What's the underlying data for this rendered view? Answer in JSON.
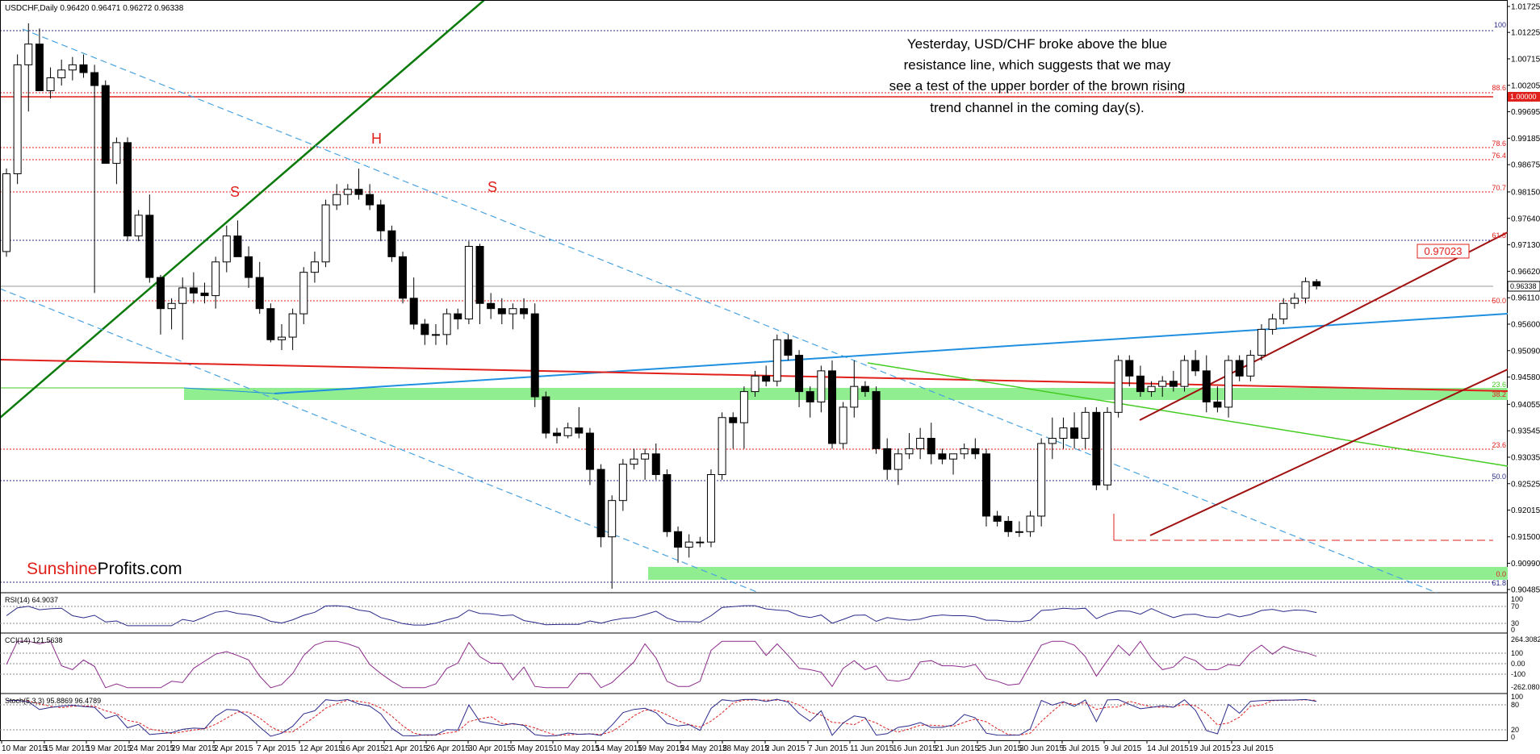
{
  "header": {
    "symbol_line": "USDCHF,Daily  0.96420 0.96471 0.96272 0.96338"
  },
  "annotation": {
    "lines": [
      "Yesterday, USD/CHF broke above the blue",
      "resistance line, which suggests that we may",
      "see a test of the upper border of the brown rising",
      "trend channel in the coming day(s)."
    ]
  },
  "watermark": {
    "part1": "Sunshine",
    "part2": "Profits.com"
  },
  "pattern_labels": [
    "S",
    "H",
    "S"
  ],
  "price_boxes": {
    "current": "0.96338",
    "level_100": "1.00000",
    "target": "0.97023"
  },
  "fib_labels": {
    "f100": "100",
    "f886": "88.6",
    "f786": "78.6",
    "f764": "76.4",
    "f707": "70.7",
    "f618a": "61.8",
    "f50a": "50.0",
    "f236a": "23.6",
    "f382": "38.2",
    "f236b": "23.6",
    "f50b": "50.0",
    "f0": "0.0",
    "f618b": "61.8"
  },
  "indicators": {
    "rsi": {
      "label": "RSI(14) 64.9037",
      "ticks": [
        "100",
        "70",
        "30",
        "0"
      ]
    },
    "cci": {
      "label": "CCI(14) 121.5638",
      "ticks": [
        "264.3082",
        "100",
        "0.00",
        "-100",
        "-262.0806"
      ]
    },
    "stoch": {
      "label": "Stoch(5,3,3) 95.8869 96.4789",
      "ticks": [
        "100",
        "80",
        "20",
        "0"
      ]
    }
  },
  "colors": {
    "bull": "#ffffff",
    "bear": "#000000",
    "trend_green": "#0a7a0a",
    "blue_dash": "#4aa3df",
    "blue_line": "#1f8fe0",
    "red_line": "#e0201a",
    "brown": "#a01010",
    "zone_green": "#90ee90",
    "light_green": "#44cc22",
    "indicator": "#2a2a8a",
    "cci_line": "#8b2a8b",
    "stoch_signal": "#e02020"
  },
  "chart_data": {
    "type": "candlestick",
    "title": "USDCHF,Daily",
    "ylim": [
      0.90485,
      1.01725
    ],
    "y_ticks": [
      "1.01725",
      "1.01225",
      "1.00715",
      "1.00205",
      "0.99695",
      "0.99185",
      "0.98675",
      "0.98150",
      "0.97640",
      "0.97130",
      "0.96620",
      "0.96110",
      "0.95600",
      "0.95090",
      "0.94580",
      "0.94055",
      "0.93545",
      "0.93035",
      "0.92525",
      "0.92015",
      "0.91500",
      "0.90990",
      "0.90485"
    ],
    "x_ticks": [
      "10 Mar 2015",
      "15 Mar 2015",
      "19 Mar 2015",
      "24 Mar 2015",
      "29 Mar 2015",
      "2 Apr 2015",
      "7 Apr 2015",
      "12 Apr 2015",
      "16 Apr 2015",
      "21 Apr 2015",
      "26 Apr 2015",
      "30 Apr 2015",
      "5 May 2015",
      "10 May 2015",
      "14 May 2015",
      "19 May 2015",
      "24 May 2015",
      "28 May 2015",
      "2 Jun 2015",
      "7 Jun 2015",
      "11 Jun 2015",
      "16 Jun 2015",
      "21 Jun 2015",
      "25 Jun 2015",
      "30 Jun 2015",
      "5 Jul 2015",
      "9 Jul 2015",
      "14 Jul 2015",
      "19 Jul 2015",
      "23 Jul 2015"
    ],
    "ohlc": [
      [
        0.97,
        0.986,
        0.969,
        0.985
      ],
      [
        0.985,
        1.008,
        0.983,
        1.006
      ],
      [
        1.006,
        1.014,
        0.997,
        1.01
      ],
      [
        1.01,
        1.013,
        1.001,
        1.001
      ],
      [
        1.001,
        1.0055,
        0.9995,
        1.0035
      ],
      [
        1.0035,
        1.007,
        1.002,
        1.005
      ],
      [
        1.005,
        1.0075,
        1.003,
        1.006
      ],
      [
        1.006,
        1.008,
        1.0035,
        1.0045
      ],
      [
        1.0045,
        1.006,
        0.962,
        1.002
      ],
      [
        1.002,
        1.003,
        0.987,
        0.987
      ],
      [
        0.987,
        0.992,
        0.983,
        0.991
      ],
      [
        0.991,
        0.992,
        0.972,
        0.973
      ],
      [
        0.973,
        0.978,
        0.972,
        0.977
      ],
      [
        0.977,
        0.981,
        0.964,
        0.965
      ],
      [
        0.965,
        0.9655,
        0.954,
        0.959
      ],
      [
        0.959,
        0.961,
        0.955,
        0.96
      ],
      [
        0.96,
        0.965,
        0.953,
        0.963
      ],
      [
        0.963,
        0.966,
        0.96,
        0.962
      ],
      [
        0.962,
        0.964,
        0.96,
        0.9615
      ],
      [
        0.9615,
        0.969,
        0.959,
        0.968
      ],
      [
        0.968,
        0.975,
        0.966,
        0.973
      ],
      [
        0.973,
        0.976,
        0.969,
        0.969
      ],
      [
        0.969,
        0.971,
        0.963,
        0.965
      ],
      [
        0.965,
        0.968,
        0.958,
        0.959
      ],
      [
        0.959,
        0.96,
        0.9525,
        0.953
      ],
      [
        0.953,
        0.956,
        0.951,
        0.9535
      ],
      [
        0.9535,
        0.959,
        0.951,
        0.958
      ],
      [
        0.958,
        0.967,
        0.956,
        0.966
      ],
      [
        0.966,
        0.97,
        0.964,
        0.968
      ],
      [
        0.968,
        0.98,
        0.967,
        0.979
      ],
      [
        0.979,
        0.983,
        0.978,
        0.981
      ],
      [
        0.981,
        0.983,
        0.979,
        0.982
      ],
      [
        0.982,
        0.986,
        0.98,
        0.981
      ],
      [
        0.981,
        0.983,
        0.978,
        0.979
      ],
      [
        0.979,
        0.98,
        0.972,
        0.974
      ],
      [
        0.974,
        0.975,
        0.968,
        0.969
      ],
      [
        0.969,
        0.97,
        0.96,
        0.961
      ],
      [
        0.961,
        0.965,
        0.955,
        0.956
      ],
      [
        0.956,
        0.957,
        0.952,
        0.954
      ],
      [
        0.954,
        0.956,
        0.952,
        0.954
      ],
      [
        0.954,
        0.959,
        0.952,
        0.958
      ],
      [
        0.958,
        0.959,
        0.955,
        0.957
      ],
      [
        0.957,
        0.972,
        0.956,
        0.971
      ],
      [
        0.971,
        0.9715,
        0.956,
        0.96
      ],
      [
        0.96,
        0.962,
        0.957,
        0.959
      ],
      [
        0.959,
        0.961,
        0.956,
        0.958
      ],
      [
        0.958,
        0.96,
        0.955,
        0.959
      ],
      [
        0.959,
        0.961,
        0.957,
        0.958
      ],
      [
        0.958,
        0.96,
        0.94,
        0.942
      ],
      [
        0.942,
        0.943,
        0.934,
        0.935
      ],
      [
        0.935,
        0.936,
        0.933,
        0.9345
      ],
      [
        0.9345,
        0.937,
        0.934,
        0.936
      ],
      [
        0.936,
        0.94,
        0.934,
        0.935
      ],
      [
        0.935,
        0.936,
        0.925,
        0.928
      ],
      [
        0.928,
        0.929,
        0.913,
        0.915
      ],
      [
        0.915,
        0.923,
        0.905,
        0.922
      ],
      [
        0.922,
        0.93,
        0.92,
        0.929
      ],
      [
        0.929,
        0.932,
        0.928,
        0.93
      ],
      [
        0.93,
        0.932,
        0.926,
        0.931
      ],
      [
        0.931,
        0.933,
        0.926,
        0.927
      ],
      [
        0.927,
        0.928,
        0.915,
        0.916
      ],
      [
        0.916,
        0.917,
        0.91,
        0.913
      ],
      [
        0.913,
        0.9155,
        0.911,
        0.914
      ],
      [
        0.914,
        0.915,
        0.913,
        0.914
      ],
      [
        0.914,
        0.928,
        0.913,
        0.927
      ],
      [
        0.927,
        0.939,
        0.926,
        0.938
      ],
      [
        0.938,
        0.939,
        0.932,
        0.937
      ],
      [
        0.937,
        0.944,
        0.932,
        0.943
      ],
      [
        0.943,
        0.947,
        0.942,
        0.946
      ],
      [
        0.946,
        0.948,
        0.944,
        0.945
      ],
      [
        0.945,
        0.954,
        0.944,
        0.953
      ],
      [
        0.953,
        0.954,
        0.949,
        0.95
      ],
      [
        0.95,
        0.951,
        0.94,
        0.943
      ],
      [
        0.943,
        0.944,
        0.938,
        0.941
      ],
      [
        0.941,
        0.948,
        0.939,
        0.947
      ],
      [
        0.947,
        0.949,
        0.932,
        0.933
      ],
      [
        0.933,
        0.941,
        0.932,
        0.94
      ],
      [
        0.94,
        0.949,
        0.938,
        0.944
      ],
      [
        0.944,
        0.945,
        0.942,
        0.943
      ],
      [
        0.943,
        0.944,
        0.931,
        0.932
      ],
      [
        0.932,
        0.934,
        0.926,
        0.928
      ],
      [
        0.928,
        0.932,
        0.925,
        0.931
      ],
      [
        0.931,
        0.935,
        0.93,
        0.932
      ],
      [
        0.932,
        0.936,
        0.93,
        0.934
      ],
      [
        0.934,
        0.937,
        0.929,
        0.931
      ],
      [
        0.931,
        0.932,
        0.929,
        0.93
      ],
      [
        0.93,
        0.931,
        0.927,
        0.931
      ],
      [
        0.931,
        0.933,
        0.93,
        0.932
      ],
      [
        0.932,
        0.934,
        0.93,
        0.931
      ],
      [
        0.931,
        0.932,
        0.917,
        0.919
      ],
      [
        0.919,
        0.92,
        0.917,
        0.918
      ],
      [
        0.918,
        0.919,
        0.915,
        0.916
      ],
      [
        0.916,
        0.918,
        0.915,
        0.916
      ],
      [
        0.916,
        0.92,
        0.915,
        0.919
      ],
      [
        0.919,
        0.934,
        0.917,
        0.933
      ],
      [
        0.933,
        0.938,
        0.93,
        0.934
      ],
      [
        0.934,
        0.938,
        0.932,
        0.936
      ],
      [
        0.936,
        0.939,
        0.932,
        0.934
      ],
      [
        0.934,
        0.94,
        0.932,
        0.939
      ],
      [
        0.939,
        0.94,
        0.924,
        0.925
      ],
      [
        0.925,
        0.94,
        0.924,
        0.939
      ],
      [
        0.939,
        0.95,
        0.938,
        0.949
      ],
      [
        0.949,
        0.95,
        0.944,
        0.946
      ],
      [
        0.946,
        0.948,
        0.942,
        0.943
      ],
      [
        0.943,
        0.945,
        0.942,
        0.944
      ],
      [
        0.944,
        0.946,
        0.942,
        0.945
      ],
      [
        0.945,
        0.947,
        0.943,
        0.944
      ],
      [
        0.944,
        0.95,
        0.943,
        0.949
      ],
      [
        0.949,
        0.951,
        0.946,
        0.947
      ],
      [
        0.947,
        0.95,
        0.939,
        0.941
      ],
      [
        0.941,
        0.944,
        0.939,
        0.94
      ],
      [
        0.94,
        0.95,
        0.938,
        0.949
      ],
      [
        0.949,
        0.95,
        0.945,
        0.946
      ],
      [
        0.946,
        0.951,
        0.945,
        0.95
      ],
      [
        0.95,
        0.956,
        0.949,
        0.955
      ],
      [
        0.955,
        0.958,
        0.954,
        0.957
      ],
      [
        0.957,
        0.961,
        0.956,
        0.96
      ],
      [
        0.96,
        0.962,
        0.959,
        0.961
      ],
      [
        0.961,
        0.965,
        0.96,
        0.9642
      ],
      [
        0.9642,
        0.9647,
        0.9627,
        0.9634
      ]
    ]
  }
}
